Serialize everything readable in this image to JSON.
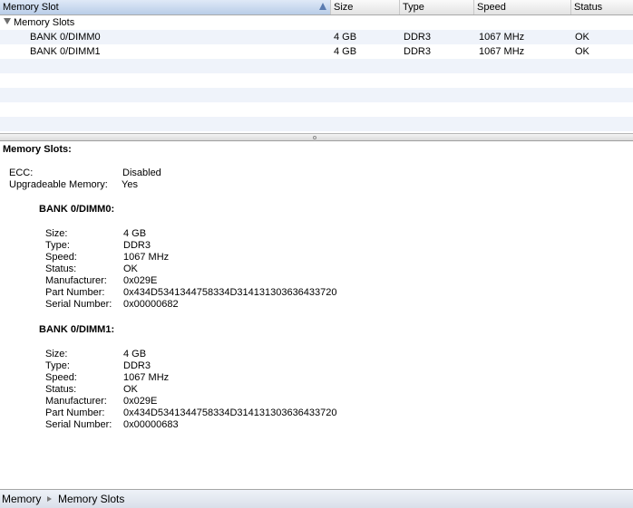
{
  "table": {
    "columns": [
      "Memory Slot",
      "Size",
      "Type",
      "Speed",
      "Status"
    ],
    "group_label": "Memory Slots",
    "rows": [
      [
        "BANK 0/DIMM0",
        "4 GB",
        "DDR3",
        "1067 MHz",
        "OK"
      ],
      [
        "BANK 0/DIMM1",
        "4 GB",
        "DDR3",
        "1067 MHz",
        "OK"
      ]
    ]
  },
  "detail": {
    "title": "Memory Slots:",
    "ecc_label": "ECC:",
    "ecc_value": "Disabled",
    "upgradeable_label": "Upgradeable Memory:",
    "upgradeable_value": "Yes",
    "banks": [
      {
        "title": "BANK 0/DIMM0:",
        "fields": [
          [
            "Size:",
            "4 GB"
          ],
          [
            "Type:",
            "DDR3"
          ],
          [
            "Speed:",
            "1067 MHz"
          ],
          [
            "Status:",
            "OK"
          ],
          [
            "Manufacturer:",
            "0x029E"
          ],
          [
            "Part Number:",
            "0x434D5341344758334D314131303636433720"
          ],
          [
            "Serial Number:",
            "0x00000682"
          ]
        ]
      },
      {
        "title": "BANK 0/DIMM1:",
        "fields": [
          [
            "Size:",
            "4 GB"
          ],
          [
            "Type:",
            "DDR3"
          ],
          [
            "Speed:",
            "1067 MHz"
          ],
          [
            "Status:",
            "OK"
          ],
          [
            "Manufacturer:",
            "0x029E"
          ],
          [
            "Part Number:",
            "0x434D5341344758334D314131303636433720"
          ],
          [
            "Serial Number:",
            "0x00000683"
          ]
        ]
      }
    ]
  },
  "pathbar": {
    "crumbs": [
      "Memory",
      "Memory Slots"
    ]
  }
}
